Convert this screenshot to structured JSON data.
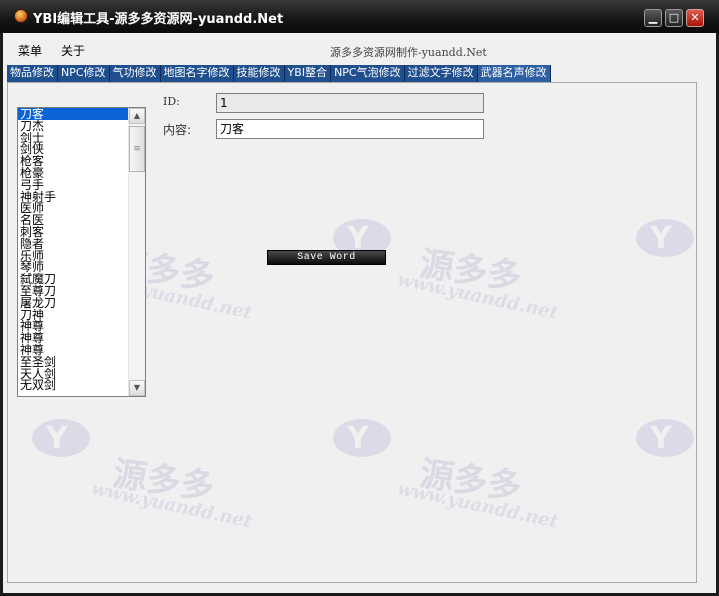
{
  "window": {
    "title": "YBI编辑工具-源多多资源网-yuandd.Net",
    "controls": {
      "minimize": "▁",
      "maximize": "□",
      "close": "✕"
    }
  },
  "menu": {
    "items": [
      "菜单",
      "关于"
    ]
  },
  "credit": "源多多资源网制作-yuandd.Net",
  "tabs": [
    {
      "label": "物品修改"
    },
    {
      "label": "NPC修改"
    },
    {
      "label": "气功修改"
    },
    {
      "label": "地图名字修改"
    },
    {
      "label": "技能修改"
    },
    {
      "label": "YBI整合"
    },
    {
      "label": "NPC气泡修改"
    },
    {
      "label": "过滤文字修改"
    },
    {
      "label": "武器名声修改"
    }
  ],
  "active_tab": "武器名声修改",
  "form": {
    "id_label": "ID:",
    "id_value": "1",
    "content_label": "内容:",
    "content_value": "刀客",
    "save_label": "Save Word"
  },
  "list": {
    "items": [
      "刀客",
      "刀杰",
      "剑士",
      "剑侠",
      "枪客",
      "枪豪",
      "弓手",
      "神射手",
      "医师",
      "名医",
      "刺客",
      "隐者",
      "乐师",
      "琴师",
      "弑魔刀",
      "至尊刀",
      "屠龙刀",
      "刀神",
      "神尊",
      "神尊",
      "神尊",
      "至圣剑",
      "天人剑",
      "无双剑"
    ],
    "selected_index": 0
  },
  "scrollbar": {
    "up": "▲",
    "down": "▼",
    "thumb": "≡"
  },
  "watermark": {
    "logo_letter": "Y",
    "text": "源多多",
    "url": "www.yuandd.net"
  }
}
